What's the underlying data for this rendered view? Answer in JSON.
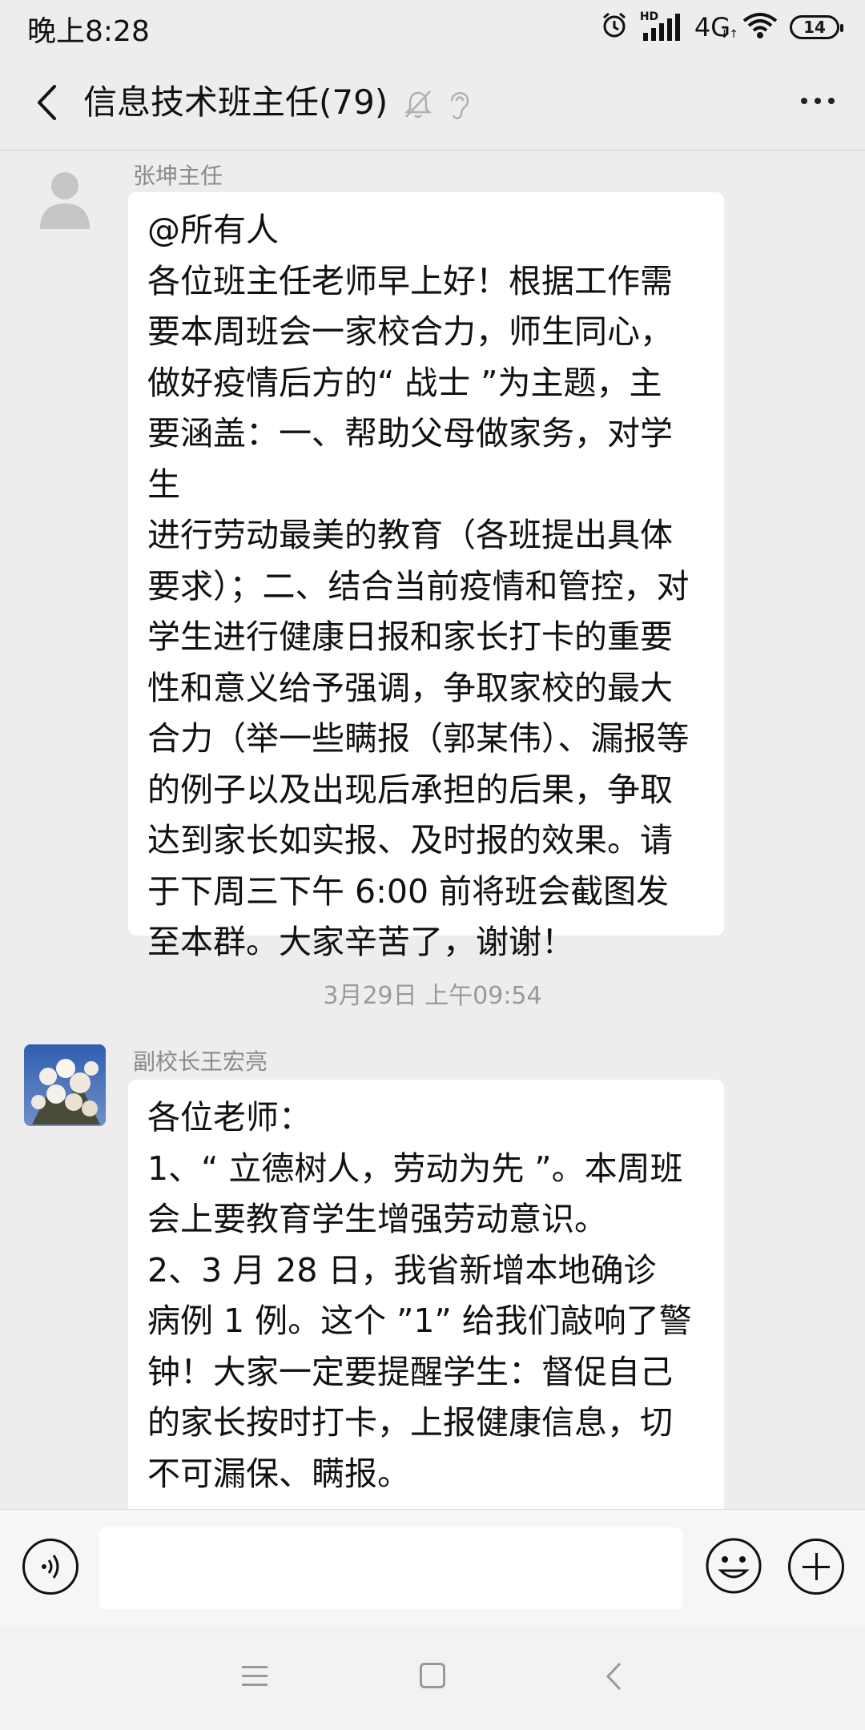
{
  "status_bar": {
    "time": "晚上8:28",
    "hd_label": "HD",
    "network": "4G",
    "battery": "14"
  },
  "nav": {
    "title": "信息技术班主任(79)"
  },
  "messages": [
    {
      "sender": "张坤主任",
      "avatar": "default-avatar-icon",
      "text": "@所有人\n各位班主任老师早上好！根据工作需\n要本周班会一家校合力，师生同心，\n做好疫情后方的“ 战士 ”为主题，主\n要涵盖：一、帮助父母做家务，对学生\n进行劳动最美的教育（各班提出具体\n要求）；二、结合当前疫情和管控，对\n学生进行健康日报和家长打卡的重要\n性和意义给予强调，争取家校的最大\n合力（举一些瞒报（郭某伟）、漏报等\n的例子以及出现后承担的后果，争取\n达到家长如实报、及时报的效果。请\n于下周三下午 6:00 前将班会截图发\n至本群。大家辛苦了，谢谢！"
    },
    {
      "timestamp": "3月29日 上午09:54"
    },
    {
      "sender": "副校长王宏亮",
      "avatar": "flower-photo-avatar",
      "text": "各位老师：\n    1、“ 立德树人，劳动为先 ”。本周班\n会上要教育学生增强劳动意识。\n     2、3 月 28 日，我省新增本地确诊\n病例 1 例。这个 ”1” 给我们敲响了警\n钟！大家一定要提醒学生：督促自己\n的家长按时打卡，上报健康信息，切\n不可漏保、瞒报。"
    }
  ],
  "input_bar": {
    "value": "",
    "placeholder": ""
  },
  "colors": {
    "background": "#ededed",
    "bubble": "#ffffff",
    "sender_name": "#8a8a8a",
    "timestamp": "#9a9a9a"
  }
}
